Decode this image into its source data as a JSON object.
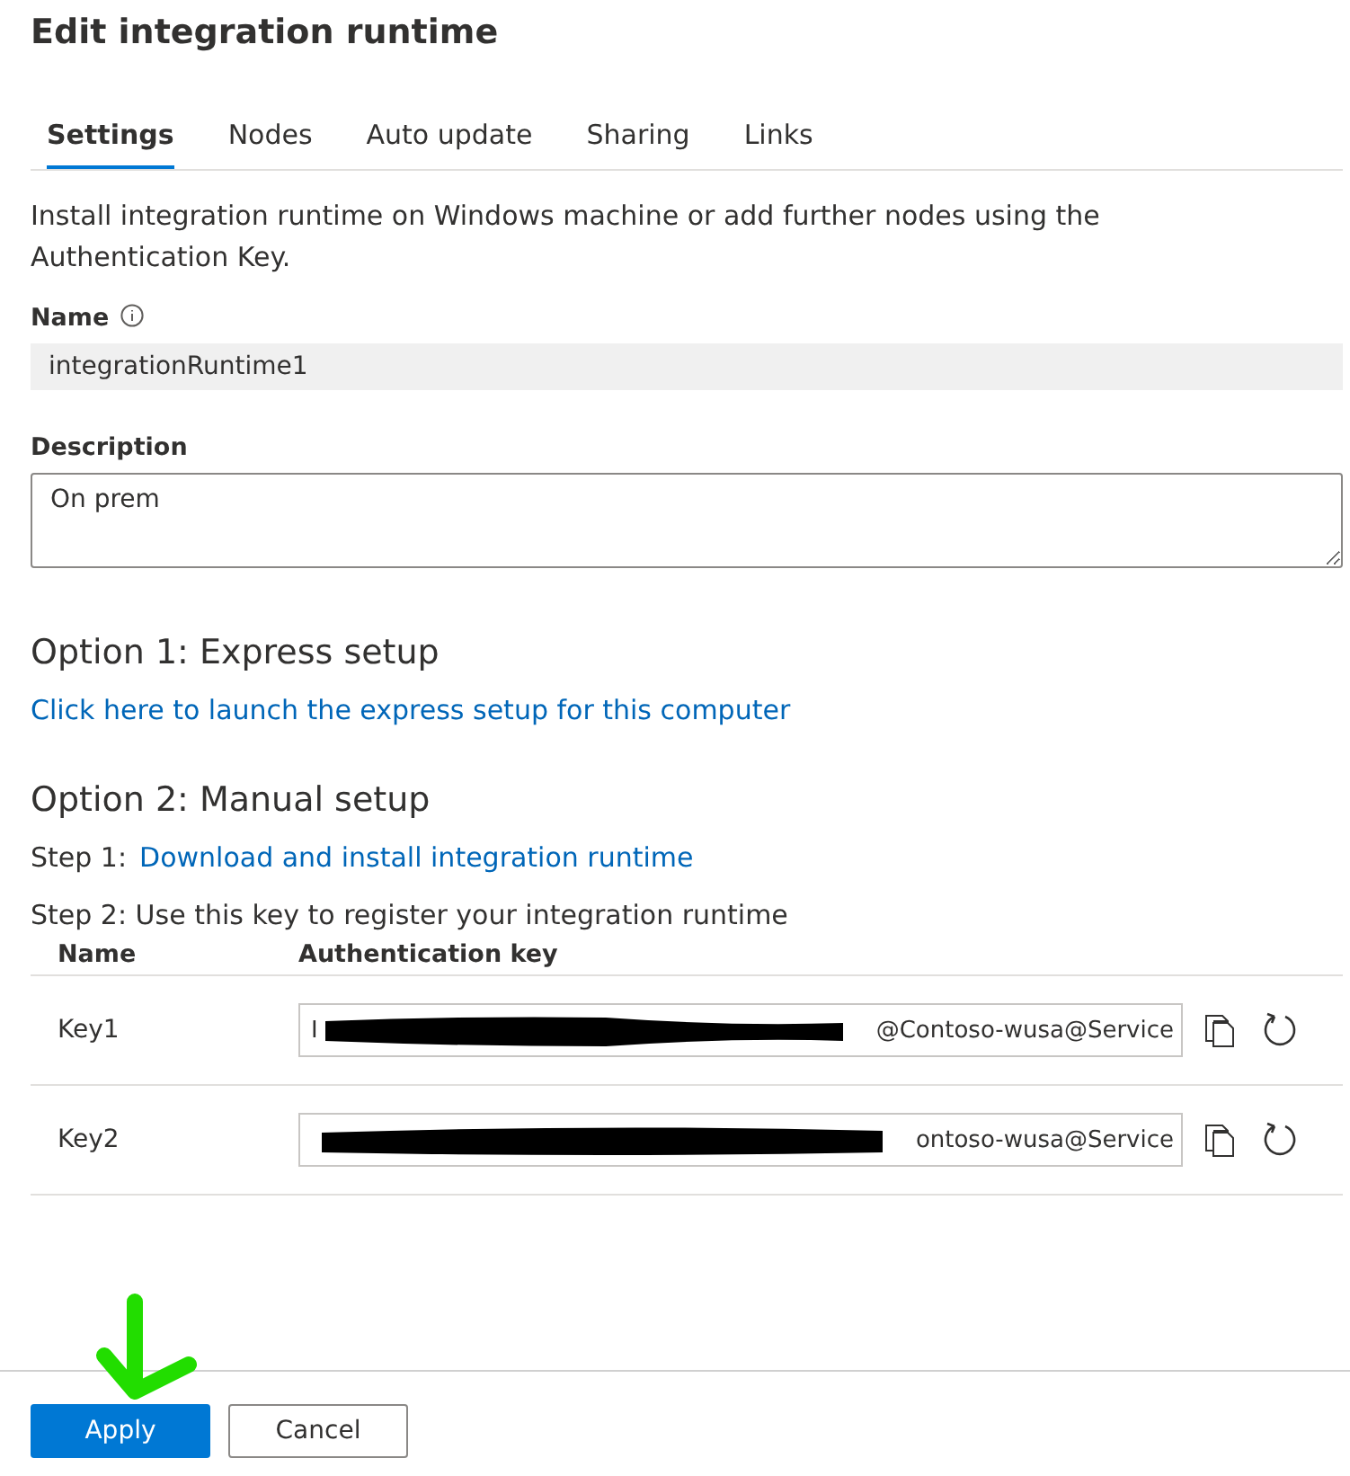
{
  "title": "Edit integration runtime",
  "tabs": [
    {
      "label": "Settings",
      "selected": true
    },
    {
      "label": "Nodes",
      "selected": false
    },
    {
      "label": "Auto update",
      "selected": false
    },
    {
      "label": "Sharing",
      "selected": false
    },
    {
      "label": "Links",
      "selected": false
    }
  ],
  "intro": "Install integration runtime on Windows machine or add further nodes using the Authentication Key.",
  "name_field": {
    "label": "Name",
    "value": "integrationRuntime1",
    "disabled": true
  },
  "description_field": {
    "label": "Description",
    "value": "On prem"
  },
  "option1": {
    "heading": "Option 1: Express setup",
    "link": "Click here to launch the express setup for this computer"
  },
  "option2": {
    "heading": "Option 2: Manual setup",
    "step1_label": "Step 1:",
    "step1_link": "Download and install integration runtime",
    "step2": "Step 2: Use this key to register your integration runtime"
  },
  "keys_table": {
    "columns": [
      "Name",
      "Authentication key"
    ],
    "rows": [
      {
        "name": "Key1",
        "key_start": "I",
        "key_end": "@Contoso-wusa@Service"
      },
      {
        "name": "Key2",
        "key_end": "ontoso-wusa@Service"
      }
    ]
  },
  "buttons": [
    {
      "label": "Apply",
      "kind": "primary"
    },
    {
      "label": "Cancel",
      "kind": "secondary"
    }
  ]
}
